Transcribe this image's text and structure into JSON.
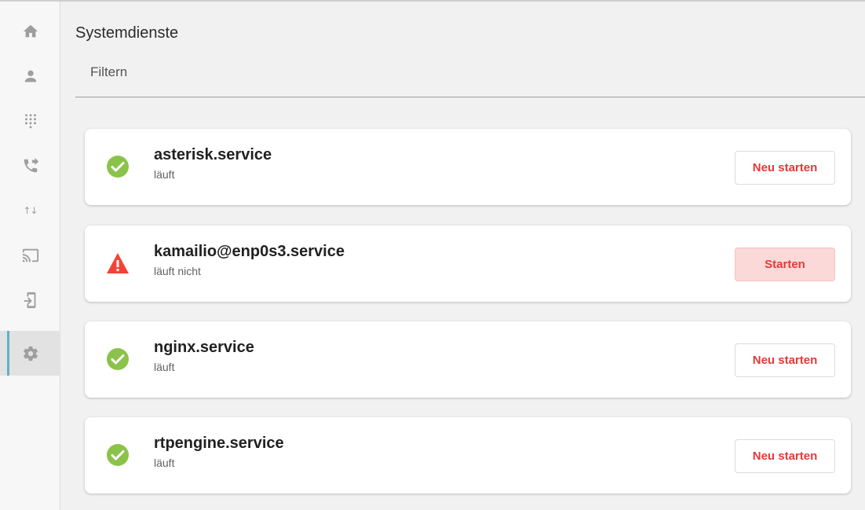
{
  "page": {
    "title": "Systemdienste"
  },
  "filter": {
    "label": "Filtern"
  },
  "sidebar": {
    "items": [
      {
        "icon": "home-icon"
      },
      {
        "icon": "user-icon"
      },
      {
        "icon": "dialpad-icon"
      },
      {
        "icon": "phone-forward-icon"
      },
      {
        "icon": "arrows-up-down-icon"
      },
      {
        "icon": "cast-icon"
      },
      {
        "icon": "device-login-icon"
      },
      {
        "icon": "gear-icon",
        "active": true
      }
    ]
  },
  "services": [
    {
      "name": "asterisk.service",
      "status": "läuft",
      "state": "ok",
      "action": "Neu starten"
    },
    {
      "name": "kamailio@enp0s3.service",
      "status": "läuft nicht",
      "state": "error",
      "action": "Starten"
    },
    {
      "name": "nginx.service",
      "status": "läuft",
      "state": "ok",
      "action": "Neu starten"
    },
    {
      "name": "rtpengine.service",
      "status": "läuft",
      "state": "ok",
      "action": "Neu starten"
    }
  ],
  "colors": {
    "ok": "#8bc34a",
    "error": "#f44336",
    "action_text": "#e53935",
    "active_accent": "#5cb3c9"
  }
}
